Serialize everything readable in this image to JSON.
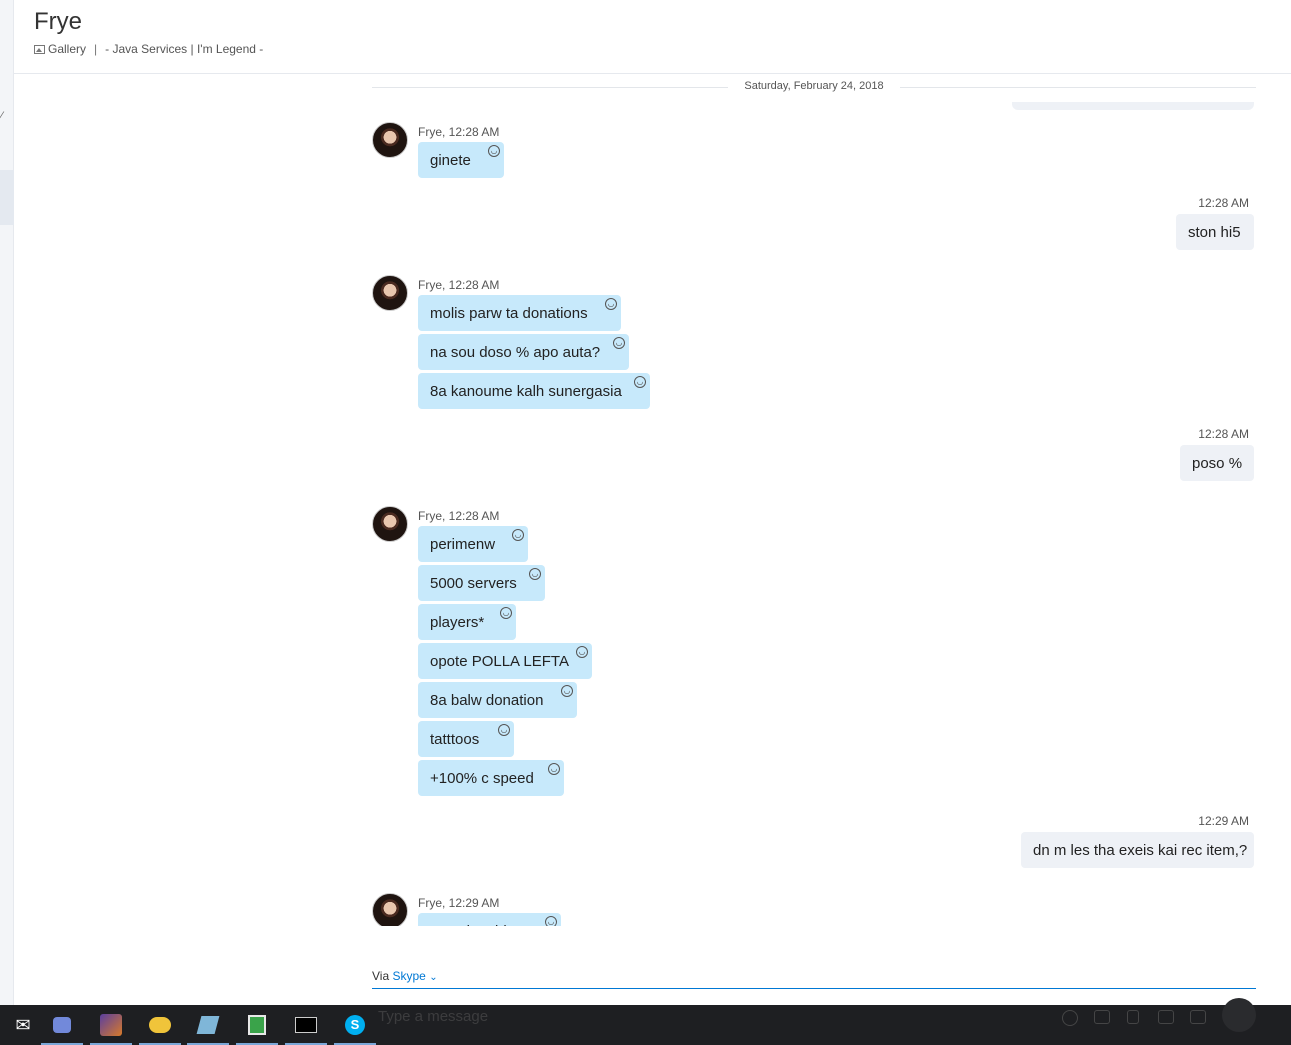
{
  "header": {
    "title": "Frye",
    "gallery_label": "Gallery",
    "separator": "|",
    "mood": "- Java Services | I'm Legend -"
  },
  "date_divider": "Saturday, February 24, 2018",
  "messages": [
    {
      "kind": "theirs",
      "meta": "Frye, 12:28 AM",
      "bubbles": [
        "ginete"
      ]
    },
    {
      "kind": "mine",
      "meta": "12:28 AM",
      "bubbles": [
        "ston hi5"
      ]
    },
    {
      "kind": "theirs",
      "meta": "Frye, 12:28 AM",
      "bubbles": [
        "molis parw ta donations",
        "na sou doso % apo auta?",
        "8a kanoume kalh sunergasia"
      ]
    },
    {
      "kind": "mine",
      "meta": "12:28 AM",
      "bubbles": [
        "poso %"
      ]
    },
    {
      "kind": "theirs",
      "meta": "Frye, 12:28 AM",
      "bubbles": [
        "perimenw",
        "5000 servers",
        "players*",
        "opote POLLA LEFTA",
        "8a balw donation",
        "tatttoos",
        "+100% c speed"
      ]
    },
    {
      "kind": "mine",
      "meta": "12:29 AM",
      "bubbles": [
        "dn m les tha exeis kai rec item,?"
      ]
    },
    {
      "kind": "theirs",
      "meta": "Frye, 12:29 AM",
      "bubbles": [
        "Hero k nobless",
        ""
      ]
    }
  ],
  "composer": {
    "via_label": "Via",
    "via_service": "Skype",
    "placeholder": "Type a message"
  },
  "taskbar": {
    "icons": [
      "mail-icon",
      "discord-icon",
      "game-launcher-icon",
      "folder-icon",
      "notepad-icon",
      "chart-app-icon",
      "terminal-icon",
      "skype-icon"
    ]
  },
  "colors": {
    "their_bubble": "#c7e9fb",
    "my_bubble": "#eef1f6",
    "accent": "#0078d4",
    "taskbar": "#1e1f22"
  }
}
